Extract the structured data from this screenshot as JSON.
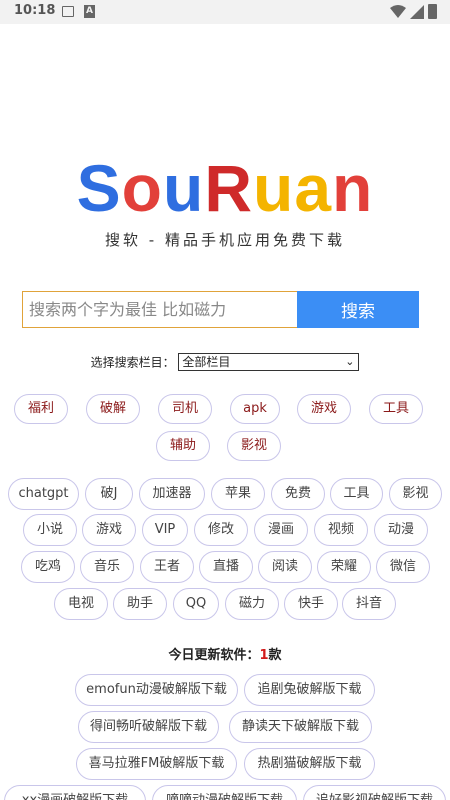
{
  "status_bar": {
    "time": "10:18",
    "icon_a": "A"
  },
  "logo": {
    "letters": [
      {
        "ch": "S",
        "color": "#2f6ee0"
      },
      {
        "ch": "o",
        "color": "#e2403a"
      },
      {
        "ch": "u",
        "color": "#2f6ee0"
      },
      {
        "ch": "R",
        "color": "#cf2a2a"
      },
      {
        "ch": "u",
        "color": "#f4b400"
      },
      {
        "ch": "a",
        "color": "#f4b400"
      },
      {
        "ch": "n",
        "color": "#e2403a"
      }
    ]
  },
  "tagline": "搜软 - 精品手机应用免费下载",
  "search": {
    "placeholder": "搜索两个字为最佳 比如磁力",
    "button_label": "搜索"
  },
  "category": {
    "label": "选择搜索栏目：",
    "selected": "全部栏目"
  },
  "hot_tags": [
    "福利",
    "破解",
    "司机",
    "apk",
    "游戏",
    "工具",
    "辅助",
    "影视"
  ],
  "tags": [
    "chatgpt",
    "破J",
    "加速器",
    "苹果",
    "免费",
    "工具",
    "影视",
    "小说",
    "游戏",
    "VIP",
    "修改",
    "漫画",
    "视频",
    "动漫",
    "吃鸡",
    "音乐",
    "王者",
    "直播",
    "阅读",
    "荣耀",
    "微信",
    "电视",
    "助手",
    "QQ",
    "磁力",
    "快手",
    "抖音"
  ],
  "today": {
    "label": "今日更新软件：",
    "count": "1",
    "unit": "款"
  },
  "software": [
    "emofun动漫破解版下载",
    "追剧兔破解版下载",
    "得间畅听破解版下载",
    "静读天下破解版下载",
    "喜马拉雅FM破解版下载",
    "热剧猫破解版下载",
    "xx漫画破解版下载",
    "嘀嘀动漫破解版下载",
    "追好影视破解版下载"
  ],
  "colors": {
    "accent": "#3b8ef5",
    "pill_border": "#c9c6ea",
    "hot_text": "#8b1a1a",
    "count": "#d21a1a"
  }
}
